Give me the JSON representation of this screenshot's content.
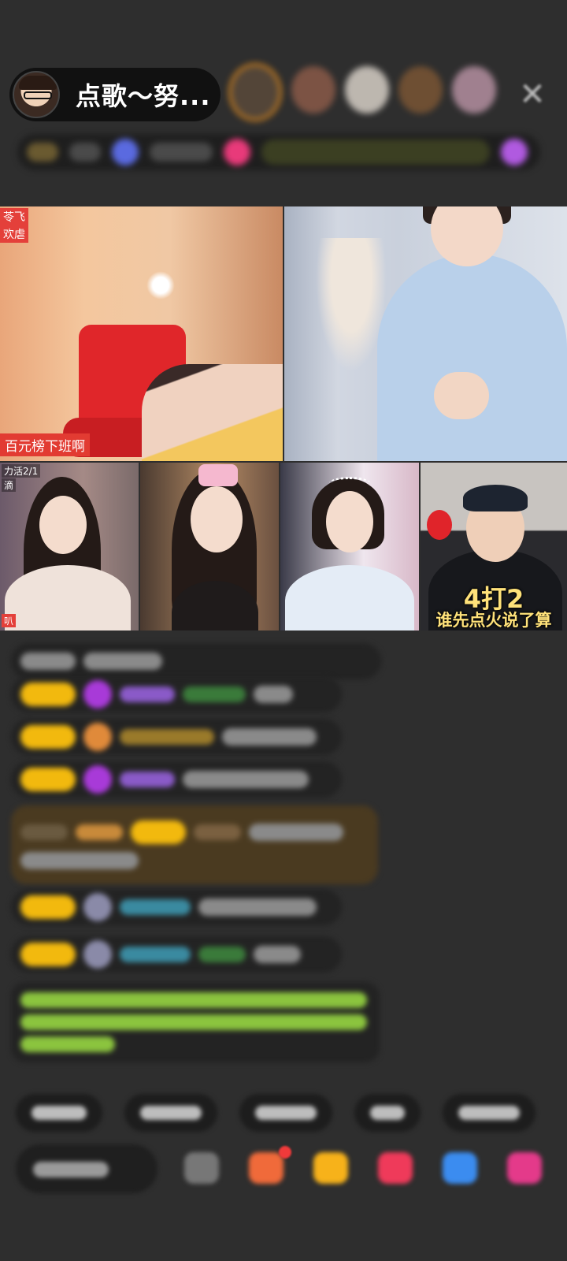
{
  "header": {
    "host_name": "点歌～努...",
    "close_icon": "close-icon",
    "viewer_count": 5
  },
  "video_grid": {
    "tile_a": {
      "tag_line1": "苓飞",
      "tag_line2": "欢虐",
      "bottom_tag": "百元榜下班啊"
    },
    "tile_c": {
      "tag_line1": "力活2/1",
      "tag_line2": "滴",
      "tag_line3": "叭"
    },
    "tile_f": {
      "overlay_big": "4打2",
      "overlay_small": "谁先点火说了算"
    }
  },
  "bottom_bar": {
    "icons": [
      "emoji-icon",
      "gift-box-icon",
      "treasure-icon",
      "heart-icon",
      "game-icon",
      "more-gift-icon"
    ]
  }
}
